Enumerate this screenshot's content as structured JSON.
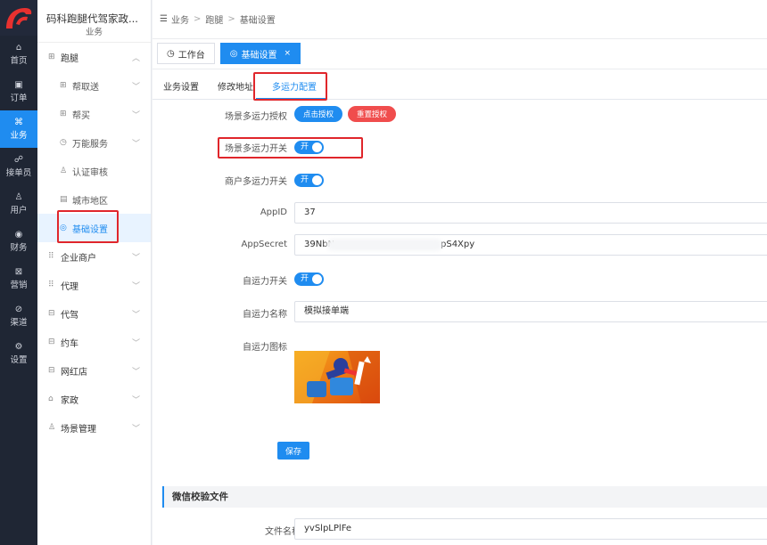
{
  "rail": {
    "items": [
      {
        "icon": "⌂",
        "label": "首页"
      },
      {
        "icon": "▣",
        "label": "订单"
      },
      {
        "icon": "⌘",
        "label": "业务"
      },
      {
        "icon": "☍",
        "label": "接单员"
      },
      {
        "icon": "♙",
        "label": "用户"
      },
      {
        "icon": "◉",
        "label": "财务"
      },
      {
        "icon": "⊠",
        "label": "营销"
      },
      {
        "icon": "⊘",
        "label": "渠道"
      },
      {
        "icon": "⚙",
        "label": "设置"
      }
    ]
  },
  "sidebar": {
    "brand": "码科跑腿代驾家政...",
    "brand_sub": "业务",
    "items": [
      {
        "label": "跑腿",
        "icon": "⊞",
        "arrow": "︿"
      },
      {
        "label": "帮取送",
        "icon": "⊞",
        "arrow": "﹀"
      },
      {
        "label": "帮买",
        "icon": "⊞",
        "arrow": "﹀"
      },
      {
        "label": "万能服务",
        "icon": "◷",
        "arrow": "﹀"
      },
      {
        "label": "认证审核",
        "icon": "♙"
      },
      {
        "label": "城市地区",
        "icon": "▤"
      },
      {
        "label": "基础设置",
        "icon": "◎"
      },
      {
        "label": "企业商户",
        "icon": "⠿",
        "arrow": "﹀"
      },
      {
        "label": "代理",
        "icon": "⠿",
        "arrow": "﹀"
      },
      {
        "label": "代驾",
        "icon": "⊟",
        "arrow": "﹀"
      },
      {
        "label": "约车",
        "icon": "⊟",
        "arrow": "﹀"
      },
      {
        "label": "网红店",
        "icon": "⊟",
        "arrow": "﹀"
      },
      {
        "label": "家政",
        "icon": "⌂",
        "arrow": "﹀"
      },
      {
        "label": "场景管理",
        "icon": "♙",
        "arrow": "﹀"
      }
    ]
  },
  "breadcrumb": {
    "fold_icon": "☰",
    "items": [
      "业务",
      "跑腿",
      "基础设置"
    ],
    "sep": ">"
  },
  "page_tabs": [
    {
      "label": "工作台",
      "icon": "◷"
    },
    {
      "label": "基础设置",
      "icon": "◎",
      "close": "×"
    }
  ],
  "settings_tabs": [
    "业务设置",
    "修改地址",
    "多运力配置"
  ],
  "form": {
    "scene_auth_label": "场景多运力授权",
    "btn_auth": "点击授权",
    "btn_reauth": "重置授权",
    "scene_switch_label": "场景多运力开关",
    "merchant_switch_label": "商户多运力开关",
    "toggle_on": "开",
    "appid_label": "AppID",
    "appid_value": "37",
    "appsecret_label": "AppSecret",
    "appsecret_value": "39NbN",
    "appsecret_tail": "pS4Xpy",
    "self_switch_label": "自运力开关",
    "self_name_label": "自运力名称",
    "self_name_value": "模拟接单端",
    "self_icon_label": "自运力图标",
    "save": "保存"
  },
  "wechat": {
    "title": "微信校验文件",
    "file_label": "文件名称",
    "file_value": "yvSlpLPlFe"
  },
  "colors": {
    "accent": "#1f8cf0",
    "danger": "#f04d4d",
    "highlight": "#e0262b",
    "rail_bg": "#1f2634"
  }
}
